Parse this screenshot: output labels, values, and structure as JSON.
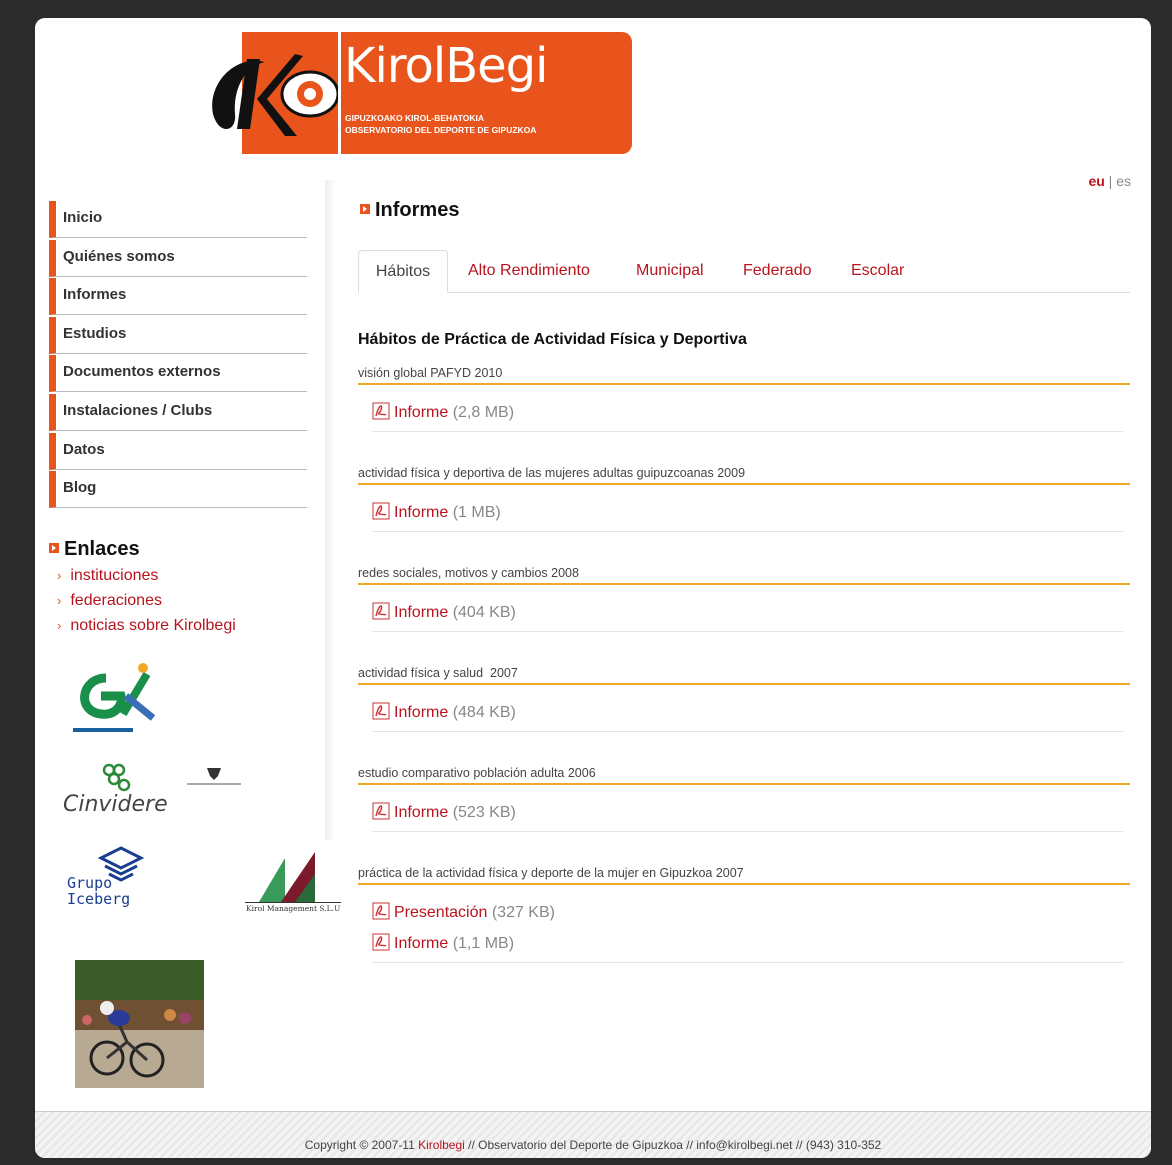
{
  "header": {
    "logo_title": "KirolBegi",
    "logo_sub1": "GIPUZKOAKO KIROL-BEHATOKIA",
    "logo_sub2": "OBSERVATORIO DEL DEPORTE DE GIPUZKOA"
  },
  "lang": {
    "eu": "eu",
    "sep": " | ",
    "es": "es"
  },
  "nav": {
    "items": [
      {
        "label": "Inicio"
      },
      {
        "label": "Quiénes somos"
      },
      {
        "label": "Informes"
      },
      {
        "label": "Estudios"
      },
      {
        "label": "Documentos externos"
      },
      {
        "label": "Instalaciones / Clubs"
      },
      {
        "label": "Datos"
      },
      {
        "label": "Blog"
      }
    ]
  },
  "enlaces": {
    "title": "Enlaces",
    "items": [
      {
        "label": "instituciones"
      },
      {
        "label": "federaciones"
      },
      {
        "label": "noticias sobre Kirolbegi"
      }
    ]
  },
  "sponsors": {
    "cinvidere": "Cinvidere",
    "grupo1": "Grupo",
    "grupo2": "Iceberg",
    "kirol": "Kirol Management S.L.U"
  },
  "main": {
    "title": "Informes",
    "tabs": [
      {
        "label": "Hábitos"
      },
      {
        "label": "Alto Rendimiento"
      },
      {
        "label": "Municipal"
      },
      {
        "label": "Federado"
      },
      {
        "label": "Escolar"
      }
    ],
    "section_heading": "Hábitos de Práctica de Actividad Física y Deportiva",
    "groups": [
      {
        "title": "visión global PAFYD 2010",
        "docs": [
          {
            "link": "Informe",
            "size": " (2,8 MB)"
          }
        ]
      },
      {
        "title": "actividad física y deportiva de las mujeres adultas guipuzcoanas 2009",
        "docs": [
          {
            "link": "Informe",
            "size": " (1 MB)"
          }
        ]
      },
      {
        "title": "redes sociales, motivos y cambios 2008",
        "docs": [
          {
            "link": "Informe",
            "size": " (404 KB)"
          }
        ]
      },
      {
        "title": "actividad física y salud  2007",
        "docs": [
          {
            "link": "Informe",
            "size": " (484 KB)"
          }
        ]
      },
      {
        "title": "estudio comparativo población adulta 2006",
        "docs": [
          {
            "link": "Informe",
            "size": " (523 KB)"
          }
        ]
      },
      {
        "title": "práctica de la actividad física y deporte de la mujer en Gipuzkoa 2007",
        "docs": [
          {
            "link": "Presentación",
            "size": " (327 KB)"
          },
          {
            "link": "Informe",
            "size": " (1,1 MB)"
          }
        ]
      }
    ]
  },
  "footer": {
    "prefix": "Copyright © 2007-11 ",
    "brand": "Kirolbegi",
    "suffix": " // Observatorio del Deporte de Gipuzkoa // info@kirolbegi.net // (943) 310-352"
  },
  "colors": {
    "brand_orange": "#e8541b",
    "link_red": "#b8141e",
    "rule_orange": "#f2a72a"
  }
}
